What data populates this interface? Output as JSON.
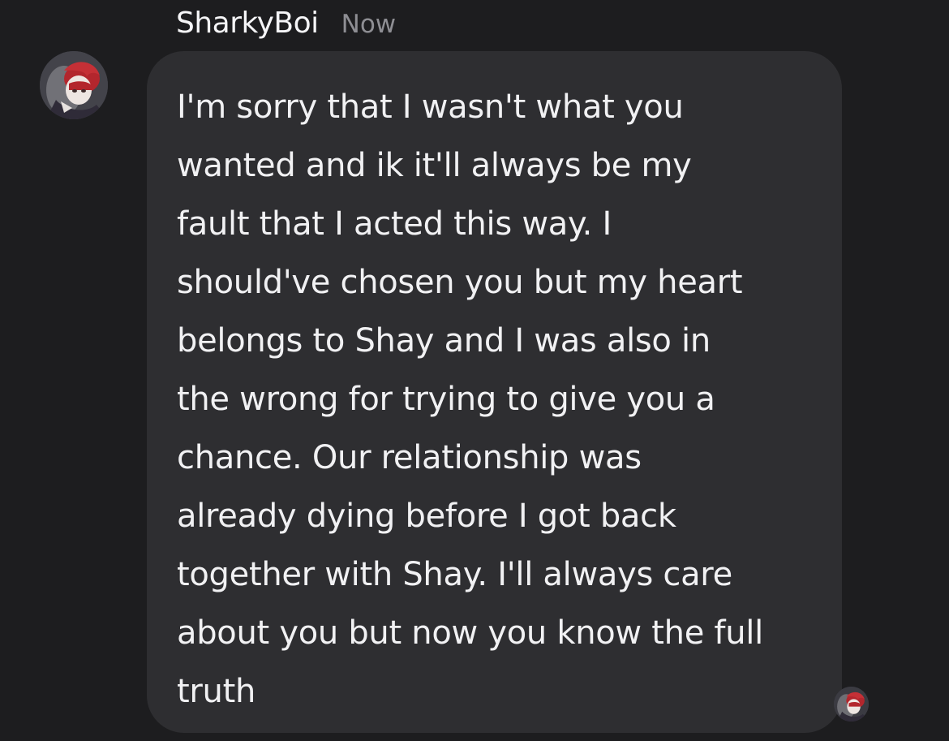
{
  "message": {
    "sender": "SharkyBoi",
    "timestamp": "Now",
    "lines": [
      "I'm sorry that I wasn't what you",
      "wanted and ik it'll always be my",
      "fault that I acted this way. I",
      "should've chosen you but my heart",
      "belongs to Shay and I was also in",
      "the wrong for trying to give you a",
      "chance. Our relationship was",
      "already dying before I got back",
      "together with Shay. I'll always care",
      "about you but now you know the full",
      "truth"
    ]
  },
  "icons": {
    "avatar": "user-avatar-icon",
    "read_receipt": "read-receipt-avatar-icon"
  },
  "colors": {
    "background": "#1d1d1f",
    "bubble": "#2e2e31",
    "text": "#f1f1f3",
    "timestamp": "#8e8e93",
    "avatar_hair": "#b3262d"
  }
}
